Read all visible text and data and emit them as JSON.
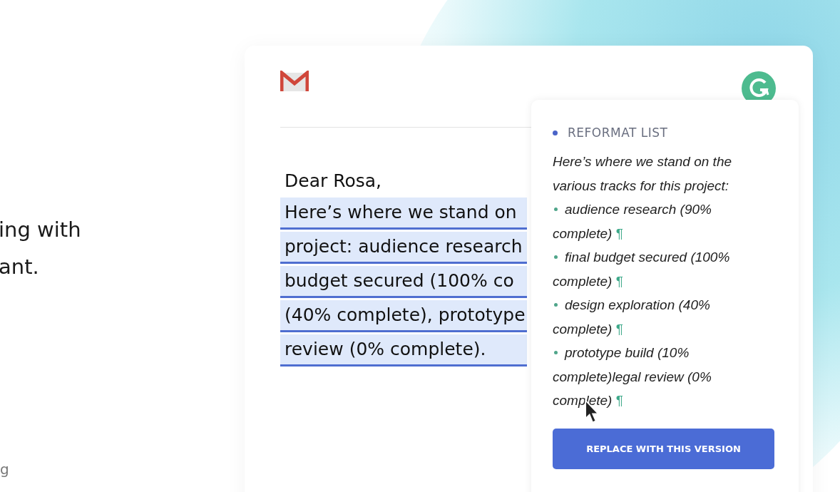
{
  "side_text": {
    "lines": [
      "ing with",
      "ant."
    ],
    "footer": "g"
  },
  "email": {
    "greeting": "Dear Rosa,",
    "lines": [
      "Here’s where we stand on",
      "project: audience research",
      "budget secured (100% co",
      "(40% complete), prototype",
      "review (0% complete)."
    ]
  },
  "popover": {
    "heading": "REFORMAT LIST",
    "intro": "Here’s where we stand on the various tracks for this project:",
    "items": [
      {
        "text": "audience research (90% complete)",
        "mark": "¶"
      },
      {
        "text": "final budget secured (100% complete)",
        "mark": "¶"
      },
      {
        "text": "design exploration (40% complete)",
        "mark": "¶"
      },
      {
        "text": "prototype build (10% complete)legal review (0% complete)",
        "mark": "¶"
      }
    ],
    "button": "REPLACE WITH THIS VERSION"
  }
}
